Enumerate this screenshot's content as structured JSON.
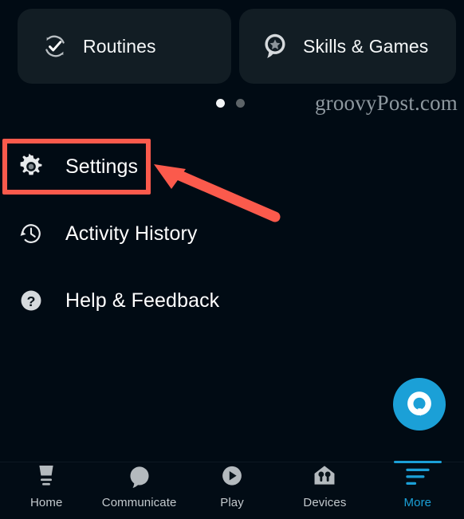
{
  "app": {
    "theme": "dark",
    "background_color": "#010b14",
    "card_color": "#121d24",
    "accent_color": "#1ba0d7",
    "annotation_color": "#fb5a4c"
  },
  "quick_cards": [
    {
      "label": "Routines",
      "icon": "routines-refresh-check-icon"
    },
    {
      "label": "Skills & Games",
      "icon": "skills-pin-star-icon"
    }
  ],
  "pagination": {
    "total": 2,
    "active_index": 0
  },
  "watermark": {
    "text": "groovyPost.com"
  },
  "menu": {
    "items": [
      {
        "label": "Settings",
        "icon": "gear-icon",
        "highlighted": true
      },
      {
        "label": "Activity History",
        "icon": "clock-history-icon",
        "highlighted": false
      },
      {
        "label": "Help & Feedback",
        "icon": "question-mark-circle-icon",
        "highlighted": false
      }
    ]
  },
  "annotation": {
    "type": "arrow-and-box",
    "target": "Settings",
    "color": "#fb5a4c"
  },
  "alexa_button": {
    "icon": "alexa-ring-icon",
    "color": "#1ba0d7"
  },
  "bottom_nav": {
    "active_index": 4,
    "items": [
      {
        "label": "Home",
        "icon": "home-icon"
      },
      {
        "label": "Communicate",
        "icon": "speech-bubble-icon"
      },
      {
        "label": "Play",
        "icon": "play-circle-icon"
      },
      {
        "label": "Devices",
        "icon": "devices-house-icon"
      },
      {
        "label": "More",
        "icon": "more-lines-icon"
      }
    ]
  }
}
